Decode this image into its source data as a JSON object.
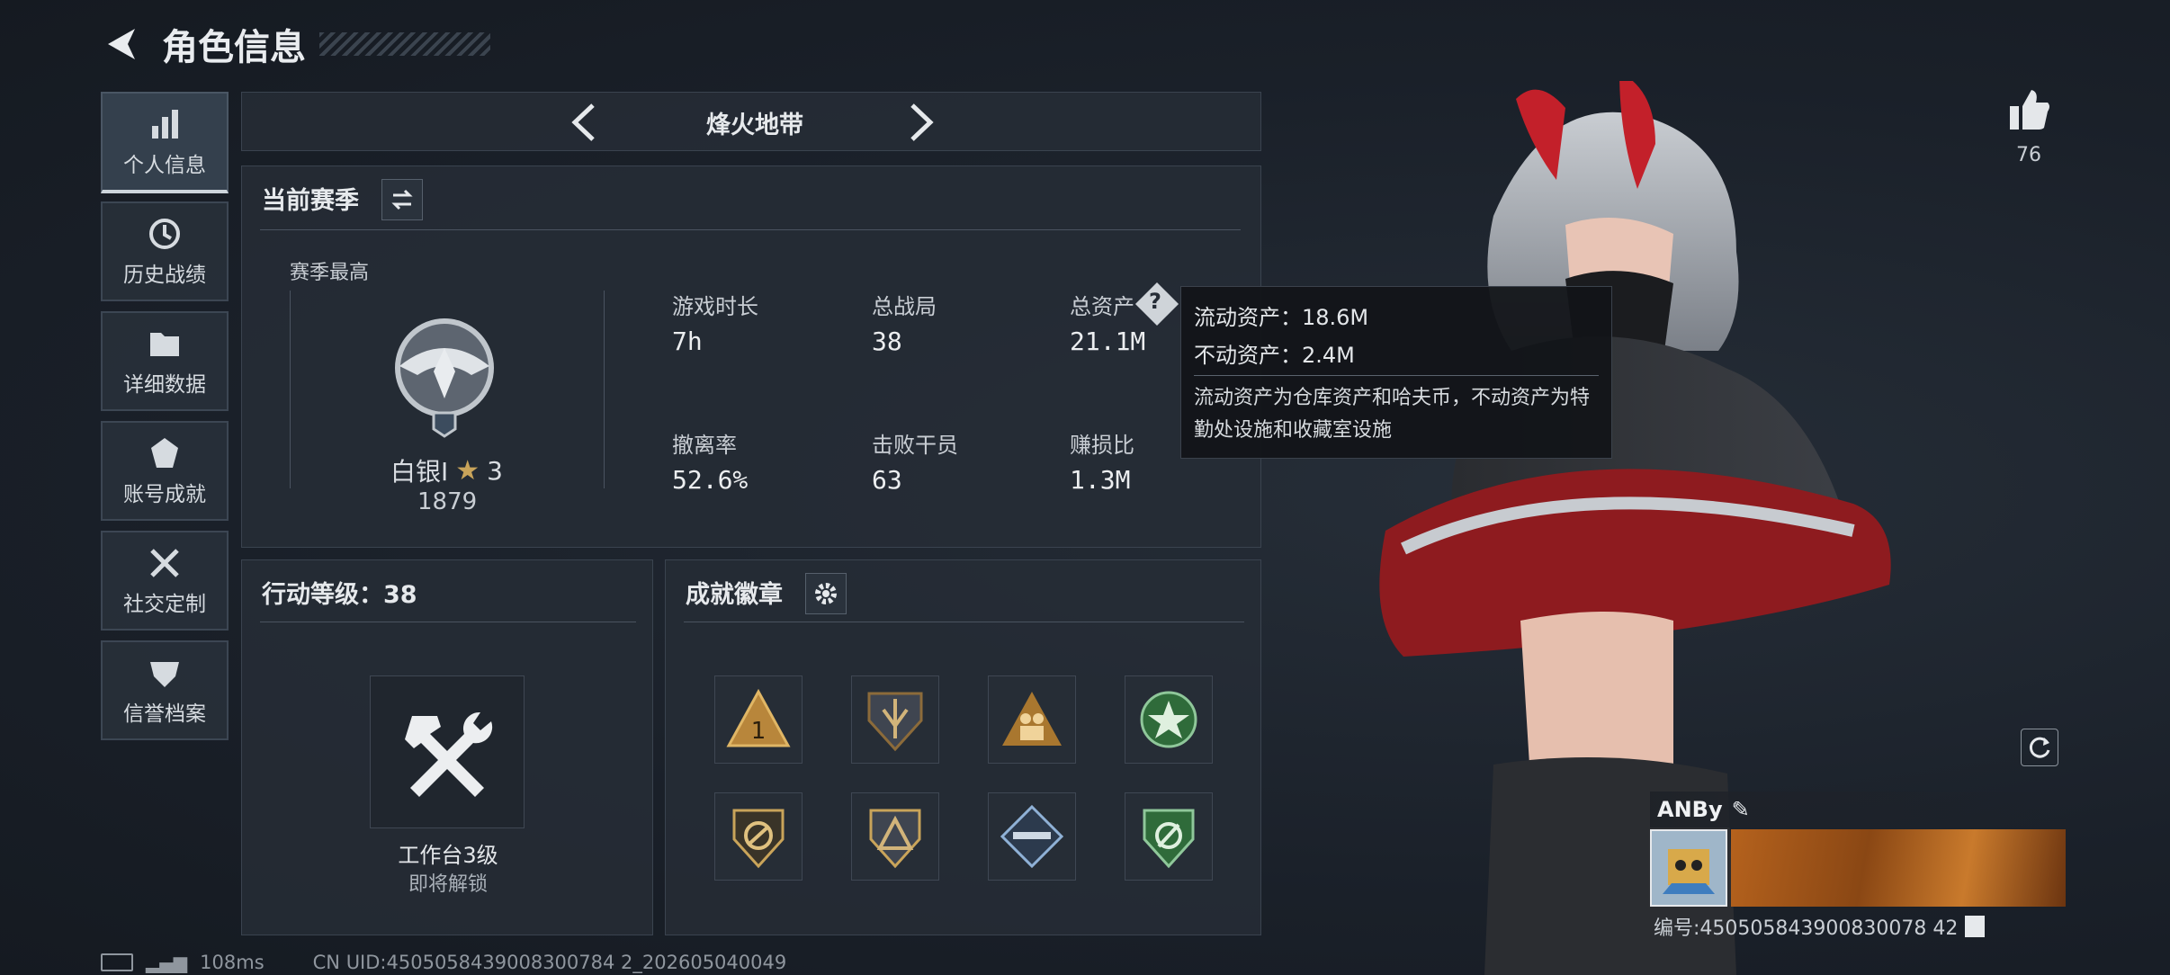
{
  "header": {
    "title": "角色信息"
  },
  "sidebar": {
    "items": [
      {
        "label": "个人信息",
        "icon": "bar-chart-icon",
        "active": true
      },
      {
        "label": "历史战绩",
        "icon": "history-icon"
      },
      {
        "label": "详细数据",
        "icon": "folder-icon"
      },
      {
        "label": "账号成就",
        "icon": "achievement-icon"
      },
      {
        "label": "社交定制",
        "icon": "tools-icon"
      },
      {
        "label": "信誉档案",
        "icon": "shield-badge-icon"
      }
    ]
  },
  "mode": {
    "title": "烽火地带"
  },
  "season": {
    "title": "当前赛季",
    "best_label": "赛季最高",
    "rank_name": "白银Ⅰ",
    "rank_stars": "3",
    "rank_score": "1879",
    "stats": [
      {
        "label": "游戏时长",
        "value": "7h"
      },
      {
        "label": "总战局",
        "value": "38"
      },
      {
        "label": "总资产",
        "value": "21.1M"
      },
      {
        "label": "撤离率",
        "value": "52.6%"
      },
      {
        "label": "击败干员",
        "value": "63"
      },
      {
        "label": "赚损比",
        "value": "1.3M"
      }
    ]
  },
  "tooltip": {
    "liquid": "流动资产：18.6M",
    "fixed": "不动资产：2.4M",
    "desc": "流动资产为仓库资产和哈夫币，不动资产为特勤处设施和收藏室设施"
  },
  "action": {
    "title": "行动等级：38",
    "workbench": "工作台3级",
    "unlock": "即将解锁"
  },
  "achievements": {
    "title": "成就徽章"
  },
  "likes": {
    "count": "76"
  },
  "player": {
    "name": "ANBy",
    "id": "编号:450505843900830078 42"
  },
  "footer": {
    "ping": "108ms",
    "uid": "CN UID:4505058439008300784 2_202605040049"
  },
  "colors": {
    "accent": "#e9ecef",
    "panel": "#252c36",
    "gold": "#c9a45a",
    "green": "#3f8a4b"
  }
}
